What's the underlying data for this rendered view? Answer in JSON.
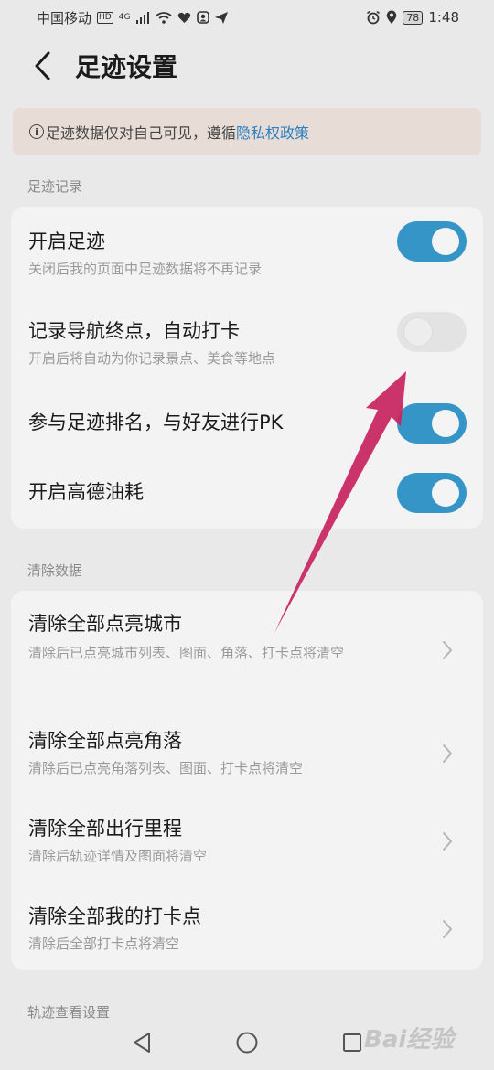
{
  "status_bar": {
    "carrier": "中国移动",
    "hd": "HD",
    "network": "4G",
    "battery": "78",
    "time": "1:48",
    "icons": [
      "signal-icon",
      "wifi-icon",
      "heart-icon",
      "face-icon",
      "send-icon",
      "alarm-icon",
      "location-icon"
    ]
  },
  "header": {
    "title": "足迹设置",
    "back_icon": "back-arrow-icon"
  },
  "notice": {
    "text": "足迹数据仅对自己可见，遵循",
    "link": "隐私权政策",
    "icon": "info-icon"
  },
  "sections": {
    "footprint": {
      "label": "足迹记录",
      "items": [
        {
          "title": "开启足迹",
          "subtitle": "关闭后我的页面中足迹数据将不再记录",
          "on": true
        },
        {
          "title": "记录导航终点，自动打卡",
          "subtitle": "开启后将自动为你记录景点、美食等地点",
          "on": false
        },
        {
          "title": "参与足迹排名，与好友进行PK",
          "subtitle": "",
          "on": true
        },
        {
          "title": "开启高德油耗",
          "subtitle": "",
          "on": true
        }
      ]
    },
    "clear": {
      "label": "清除数据",
      "items": [
        {
          "title": "清除全部点亮城市",
          "subtitle": "清除后已点亮城市列表、图面、角落、打卡点将清空"
        },
        {
          "title": "清除全部点亮角落",
          "subtitle": "清除后已点亮角落列表、图面、打卡点将清空"
        },
        {
          "title": "清除全部出行里程",
          "subtitle": "清除后轨迹详情及图面将清空"
        },
        {
          "title": "清除全部我的打卡点",
          "subtitle": "清除后全部打卡点将清空"
        }
      ]
    },
    "track": {
      "label": "轨迹查看设置"
    }
  },
  "watermark": "Bai经验",
  "colors": {
    "accent": "#3595c6",
    "link": "#2a7fc2",
    "notice_bg": "#e8ddd6",
    "annotation_arrow": "#c8245e"
  }
}
